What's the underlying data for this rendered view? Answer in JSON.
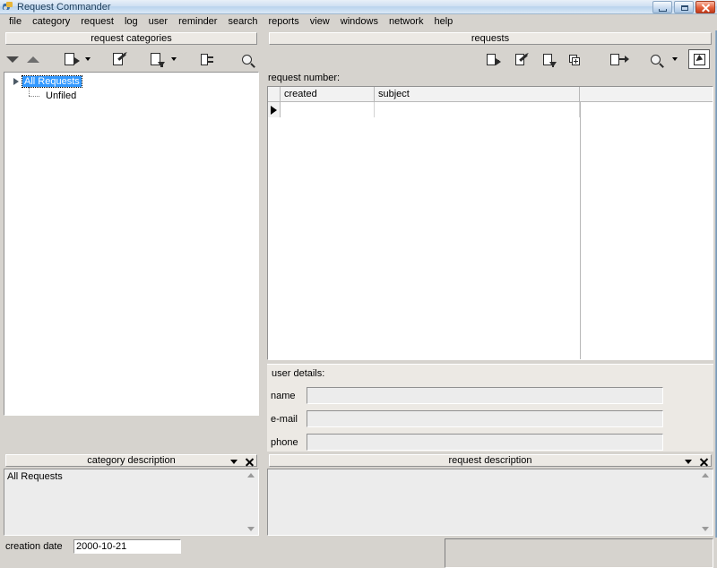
{
  "window": {
    "title": "Request Commander",
    "icon": "app-icon",
    "buttons": {
      "minimize": "minimize",
      "maximize": "maximize",
      "close": "close"
    }
  },
  "menubar": {
    "items": [
      {
        "label": "file"
      },
      {
        "label": "category"
      },
      {
        "label": "request"
      },
      {
        "label": "log"
      },
      {
        "label": "user"
      },
      {
        "label": "reminder"
      },
      {
        "label": "search"
      },
      {
        "label": "reports"
      },
      {
        "label": "view"
      },
      {
        "label": "windows"
      },
      {
        "label": "network"
      },
      {
        "label": "help"
      }
    ]
  },
  "categories_panel": {
    "caption": "request categories",
    "toolbar": [
      {
        "name": "move-down-button",
        "icon": "triangle-down-icon"
      },
      {
        "name": "move-up-button",
        "icon": "triangle-up-icon"
      },
      {
        "name": "new-category-button",
        "icon": "document-add-icon",
        "has_dropdown": true
      },
      {
        "name": "edit-category-button",
        "icon": "document-edit-icon"
      },
      {
        "name": "export-category-button",
        "icon": "document-export-icon",
        "has_dropdown": true
      },
      {
        "name": "category-tree-button",
        "icon": "document-tree-icon"
      },
      {
        "name": "search-categories-button",
        "icon": "magnifier-icon"
      }
    ],
    "tree": [
      {
        "label": "All Requests",
        "selected": true,
        "expanded": true,
        "level": 0
      },
      {
        "label": "Unfiled",
        "selected": false,
        "level": 1
      }
    ]
  },
  "category_description_panel": {
    "caption": "category description",
    "dropdown_icon": "chevron-down-icon",
    "close_icon": "close-icon",
    "text": "All Requests",
    "fields": [
      {
        "label": "creation date",
        "value": "2000-10-21"
      }
    ]
  },
  "requests_panel": {
    "caption": "requests",
    "toolbar": [
      {
        "name": "new-request-button",
        "icon": "document-in-icon"
      },
      {
        "name": "edit-request-button",
        "icon": "document-edit-icon"
      },
      {
        "name": "close-request-button",
        "icon": "document-down-icon"
      },
      {
        "name": "duplicate-request-button",
        "icon": "document-copy-add-icon"
      },
      {
        "name": "forward-request-button",
        "icon": "document-out-icon"
      },
      {
        "name": "search-requests-button",
        "icon": "magnifier-icon",
        "has_dropdown": true
      },
      {
        "name": "select-request-button",
        "icon": "document-cursor-icon",
        "pressed": true
      }
    ],
    "request_number_label": "request number:",
    "grid": {
      "columns": [
        "created",
        "subject"
      ],
      "rows": [],
      "current_row_indicator": "row-indicator-triangle"
    }
  },
  "user_details_panel": {
    "title": "user details:",
    "fields": [
      {
        "label": "name",
        "value": "",
        "placeholder": ""
      },
      {
        "label": "e-mail",
        "value": "",
        "placeholder": ""
      },
      {
        "label": "phone",
        "value": "",
        "placeholder": ""
      }
    ]
  },
  "request_description_panel": {
    "caption": "request description",
    "dropdown_icon": "chevron-down-icon",
    "close_icon": "close-icon",
    "text": ""
  }
}
